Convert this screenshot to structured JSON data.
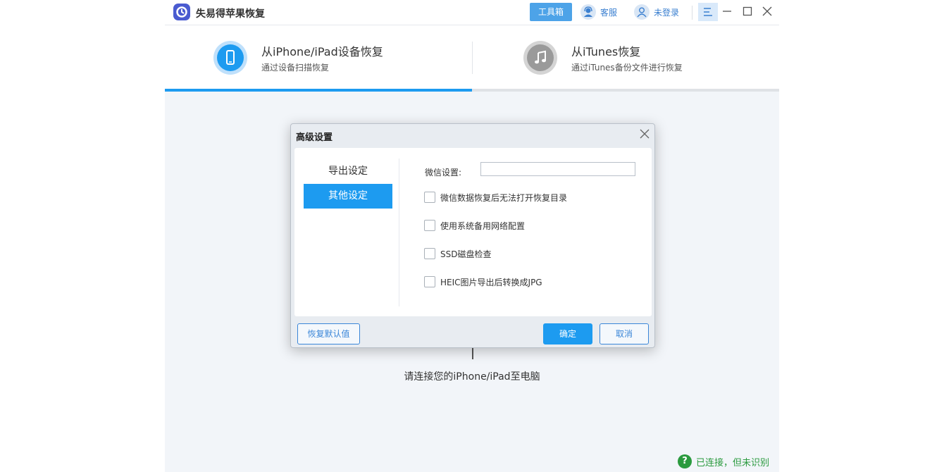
{
  "app": {
    "title": "失易得苹果恢复",
    "toolbox_label": "工具箱",
    "service_label": "客服",
    "login_label": "未登录"
  },
  "tabs": [
    {
      "title": "从iPhone/iPad设备恢复",
      "subtitle": "通过设备扫描恢复",
      "active": true
    },
    {
      "title": "从iTunes恢复",
      "subtitle": "通过iTunes备份文件进行恢复",
      "active": false
    }
  ],
  "main": {
    "connect_prompt": "请连接您的iPhone/iPad至电脑",
    "status_text": "已连接，但未识别",
    "status_icon": "?"
  },
  "dialog": {
    "title": "高级设置",
    "nav": [
      "导出设定",
      "其他设定"
    ],
    "selected_nav": "其他设定",
    "wechat_label": "微信设置:",
    "wechat_value": "",
    "options": [
      {
        "label": "微信数据恢复后无法打开恢复目录",
        "checked": false
      },
      {
        "label": "使用系统备用网络配置",
        "checked": false
      },
      {
        "label": "SSD磁盘检查",
        "checked": false
      },
      {
        "label": "HEIC图片导出后转换成JPG",
        "checked": false
      }
    ],
    "reset_label": "恢复默认值",
    "ok_label": "确定",
    "cancel_label": "取消"
  },
  "colors": {
    "accent": "#1d9bf0",
    "status_green": "#2a9a3e",
    "link_blue": "#3a7fd0"
  }
}
